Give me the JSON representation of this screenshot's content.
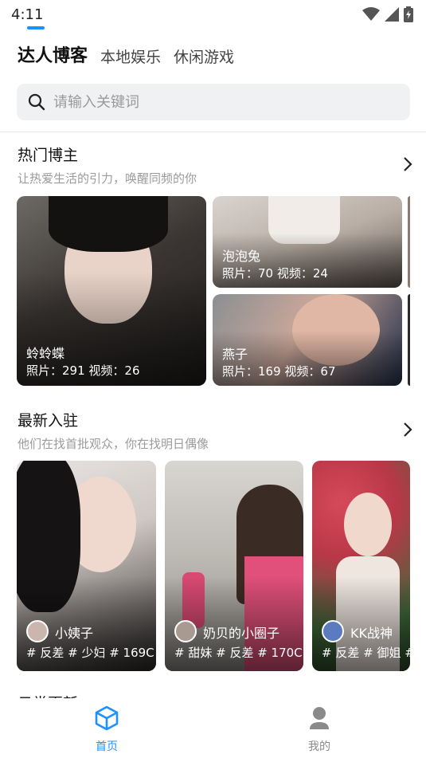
{
  "status": {
    "time": "4:11"
  },
  "tabs": [
    {
      "label": "达人博客",
      "active": true
    },
    {
      "label": "本地娱乐",
      "active": false
    },
    {
      "label": "休闲游戏",
      "active": false
    }
  ],
  "search": {
    "placeholder": "请输入关键词"
  },
  "hot": {
    "title": "热门博主",
    "subtitle": "让热爱生活的引力，唤醒同频的你",
    "cards": [
      {
        "name": "蛉蛉蝶",
        "stats": "照片：291  视频：26"
      },
      {
        "name": "泡泡兔",
        "stats": "照片：70  视频：24"
      },
      {
        "name": "燕子",
        "stats": "照片：169  视频：67"
      }
    ]
  },
  "new": {
    "title": "最新入驻",
    "subtitle": "他们在找首批观众，你在找明日偶像",
    "cards": [
      {
        "name": "小姨子",
        "tags": "# 反差 # 少妇 # 169C"
      },
      {
        "name": "奶贝的小圈子",
        "tags": "# 甜妹 # 反差 # 170C"
      },
      {
        "name": "KK战神",
        "tags": "# 反差 # 御姐 #"
      }
    ]
  },
  "next_section": {
    "title": "日常更新"
  },
  "bottom_nav": [
    {
      "label": "首页",
      "active": true
    },
    {
      "label": "我的",
      "active": false
    }
  ],
  "colors": {
    "accent": "#1E90FF",
    "nav_inactive": "#8a8a8a"
  }
}
